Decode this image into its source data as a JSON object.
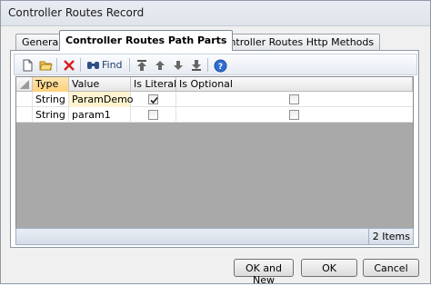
{
  "window": {
    "title": "Controller Routes Record"
  },
  "tabs": [
    {
      "label": "General",
      "active": false
    },
    {
      "label": "Controller Routes Path Parts",
      "active": true
    },
    {
      "label": "Controller Routes Http Methods",
      "active": false
    }
  ],
  "toolbar": {
    "buttons": [
      "new-icon",
      "open-folder-icon",
      "delete-icon",
      "find-icon",
      "move-top-icon",
      "move-up-icon",
      "move-down-icon",
      "move-bottom-icon",
      "help-icon"
    ],
    "find_label": "Find"
  },
  "grid": {
    "columns": [
      "Type",
      "Value",
      "Is Literal",
      "Is Optional"
    ],
    "rows": [
      {
        "type": "String",
        "value": "ParamDemo",
        "is_literal": true,
        "is_optional": false,
        "selected": true
      },
      {
        "type": "String",
        "value": "param1",
        "is_literal": false,
        "is_optional": false,
        "selected": false
      }
    ],
    "item_count": "2 Items"
  },
  "buttons": {
    "ok_and_new": "OK and New",
    "ok": "OK",
    "cancel": "Cancel"
  },
  "colors": {
    "grid_background": "#a9a9a9",
    "selected_column_header": "#ffd07a",
    "title_bar": "#e4e9f0"
  }
}
